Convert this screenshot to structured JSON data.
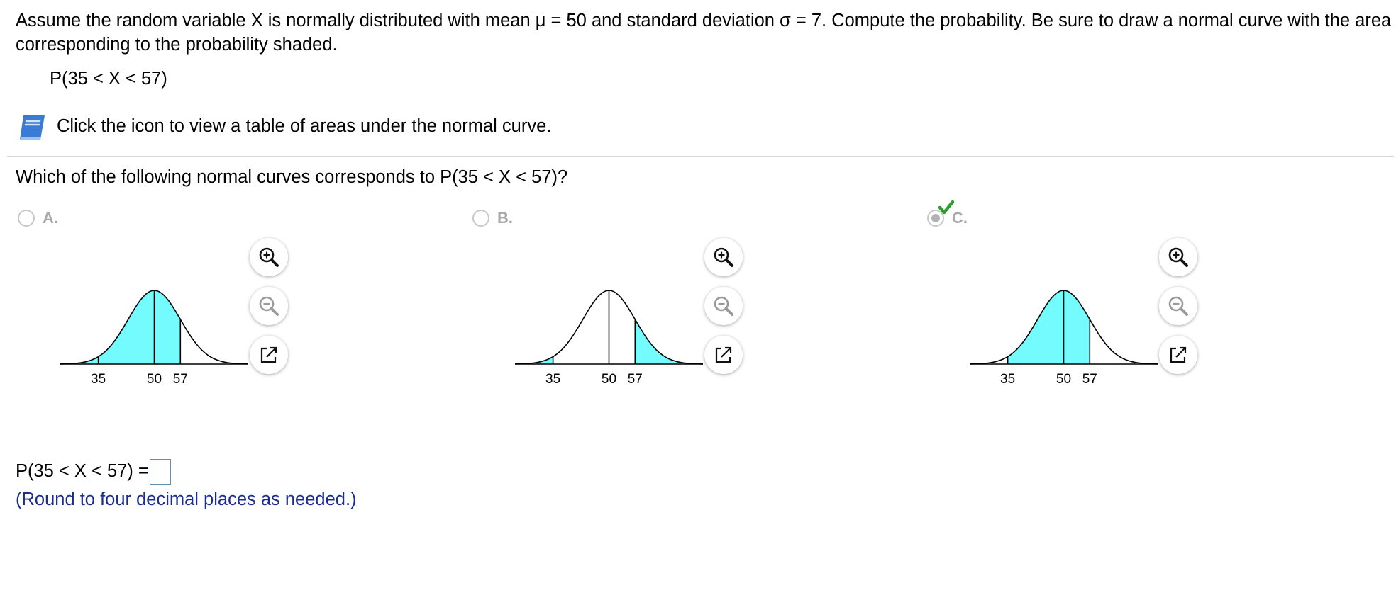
{
  "intro": "Assume the random variable X is normally distributed with mean μ = 50 and standard deviation σ = 7. Compute the probability. Be sure to draw a normal curve with the area corresponding to the probability shaded.",
  "probability_expression": "P(35 < X < 57)",
  "table_link_text": "Click the icon to view a table of areas under the normal curve.",
  "question": "Which of the following normal curves corresponds to P(35 < X < 57)?",
  "options": [
    {
      "letter": "A.",
      "selected": false,
      "shading": "left_tail_and_35_to_57",
      "ticks": [
        "35",
        "50",
        "57"
      ]
    },
    {
      "letter": "B.",
      "selected": false,
      "shading": "tails",
      "ticks": [
        "35",
        "50",
        "57"
      ]
    },
    {
      "letter": "C.",
      "selected": true,
      "correct": true,
      "shading": "35_to_57",
      "ticks": [
        "35",
        "50",
        "57"
      ]
    }
  ],
  "chart_data": {
    "type": "area",
    "mean": 50,
    "sd": 7,
    "x_range": [
      35,
      57
    ],
    "ticks": [
      35,
      50,
      57
    ]
  },
  "icons": {
    "table": "book-icon",
    "zoom_in": "zoom-in-icon",
    "zoom_out": "zoom-out-icon",
    "popout": "popout-icon",
    "correct": "checkmark-icon"
  },
  "colors": {
    "shade": "#73fbfd",
    "checkmark": "#2e9e2e",
    "note": "#1c2e8c",
    "book": "#3a7bd5"
  },
  "answer_label": "P(35 < X < 57) =",
  "answer_value": "",
  "round_note": "(Round to four decimal places as needed.)"
}
